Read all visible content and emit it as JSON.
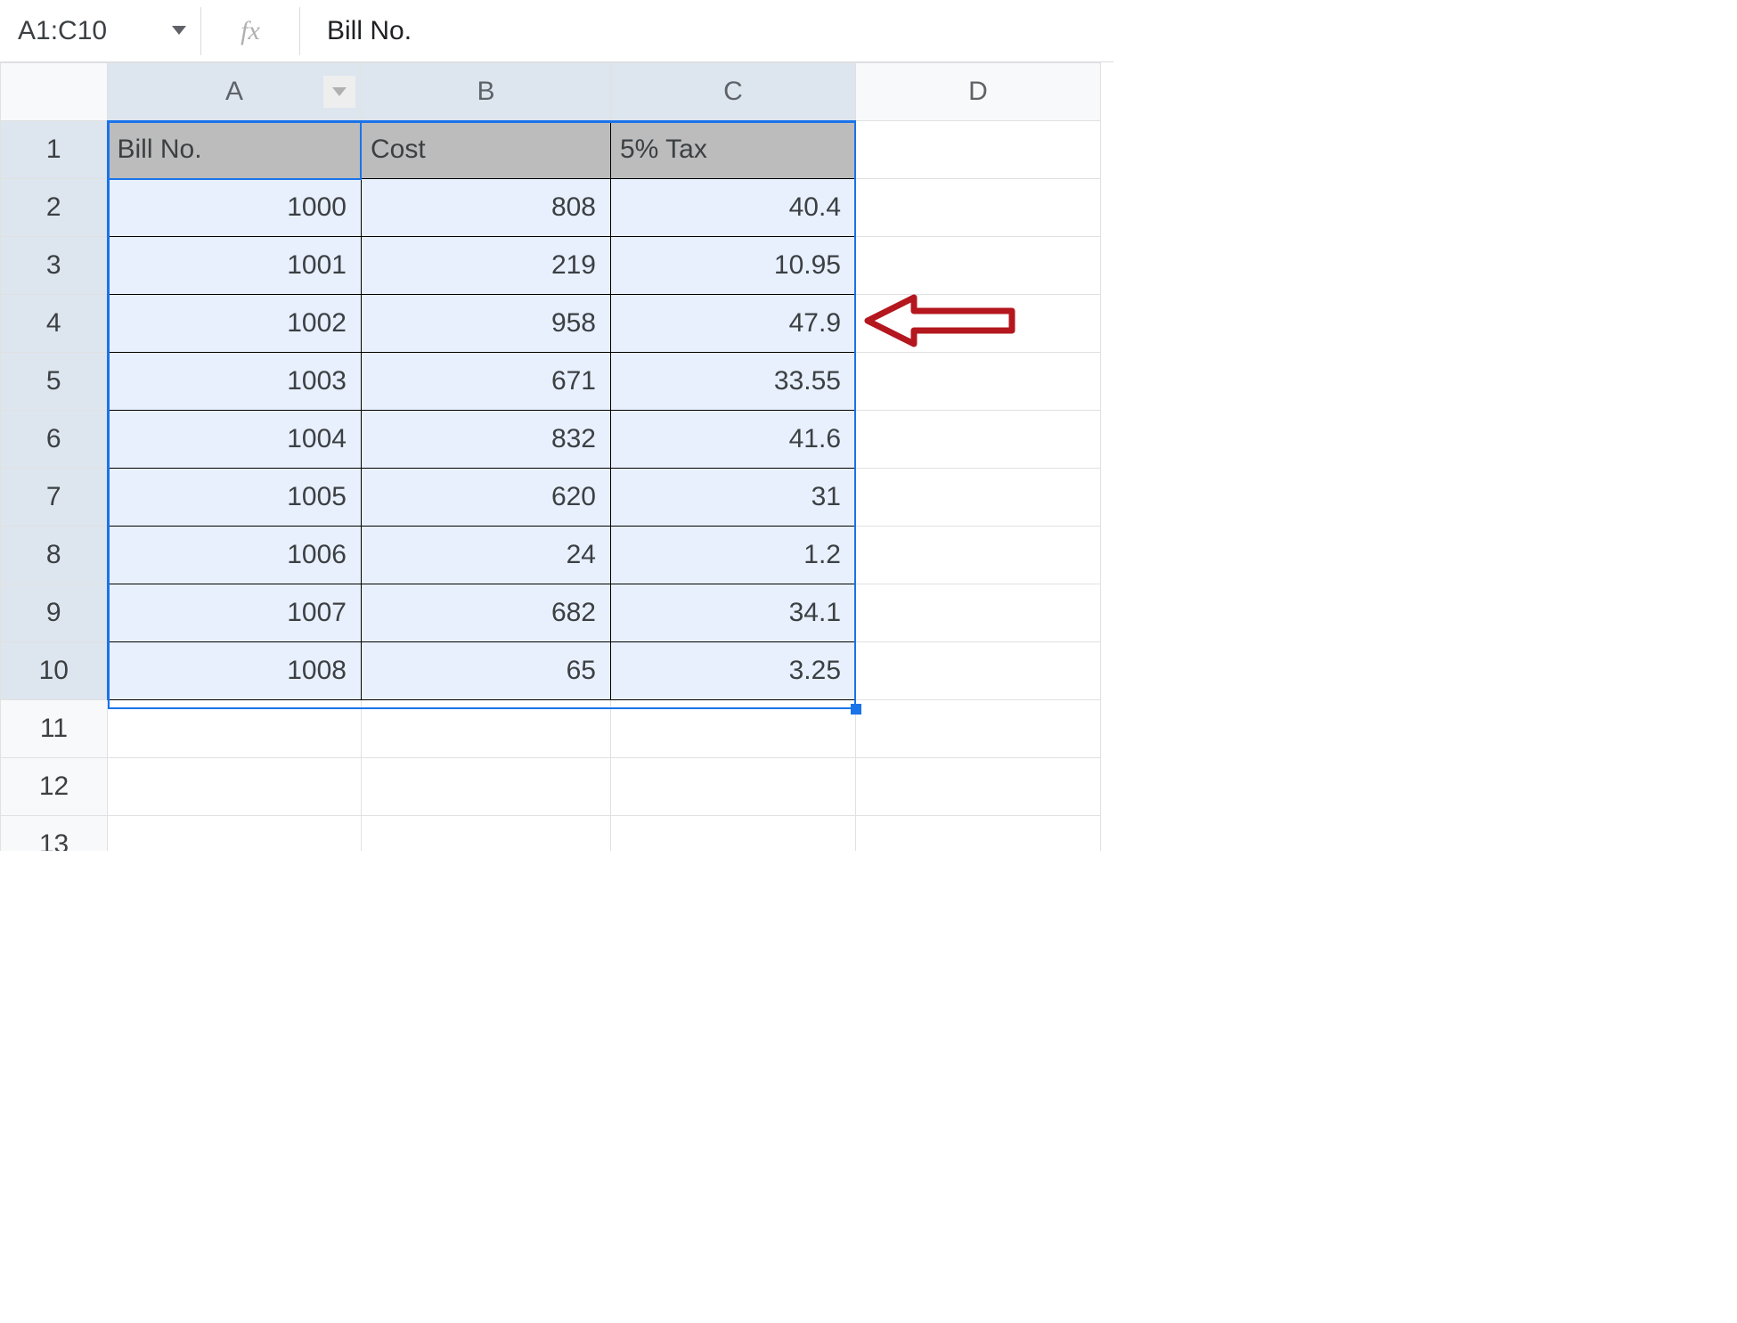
{
  "name_box": "A1:C10",
  "fx_label": "fx",
  "formula_value": "Bill No.",
  "col_headers": {
    "A": "A",
    "B": "B",
    "C": "C",
    "D": "D"
  },
  "row_indices": [
    "1",
    "2",
    "3",
    "4",
    "5",
    "6",
    "7",
    "8",
    "9",
    "10",
    "11",
    "12",
    "13"
  ],
  "header_row": {
    "A": "Bill No.",
    "B": "Cost",
    "C": "5% Tax"
  },
  "rows": [
    {
      "A": "1000",
      "B": "808",
      "C": "40.4"
    },
    {
      "A": "1001",
      "B": "219",
      "C": "10.95"
    },
    {
      "A": "1002",
      "B": "958",
      "C": "47.9"
    },
    {
      "A": "1003",
      "B": "671",
      "C": "33.55"
    },
    {
      "A": "1004",
      "B": "832",
      "C": "41.6"
    },
    {
      "A": "1005",
      "B": "620",
      "C": "31"
    },
    {
      "A": "1006",
      "B": "24",
      "C": "1.2"
    },
    {
      "A": "1007",
      "B": "682",
      "C": "34.1"
    },
    {
      "A": "1008",
      "B": "65",
      "C": "3.25"
    }
  ],
  "arrow_points_at_row": 4
}
